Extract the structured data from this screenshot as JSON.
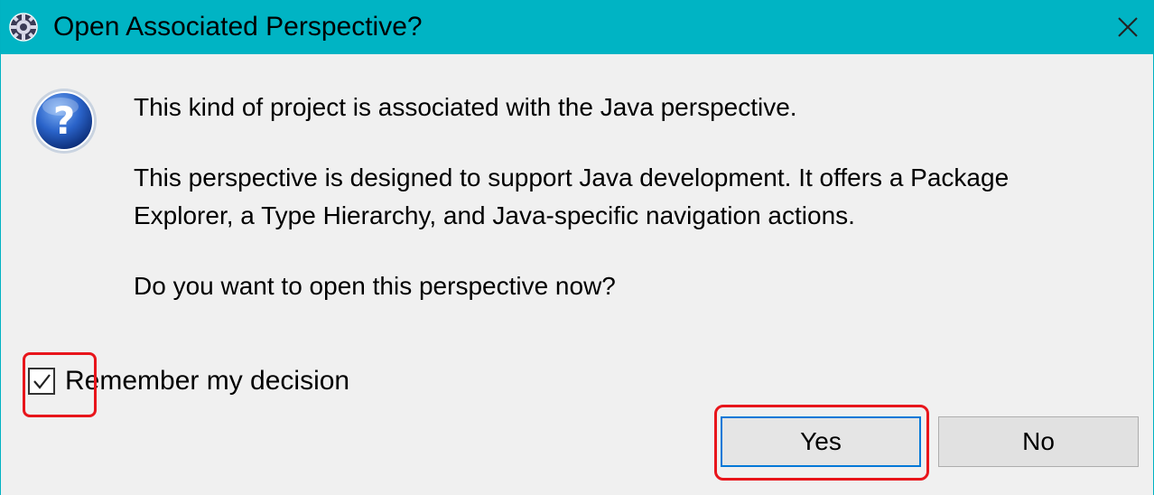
{
  "window": {
    "title": "Open Associated Perspective?",
    "app_icon": "eclipse-gear-icon",
    "close_icon": "close-icon",
    "accent_color": "#00b4c4"
  },
  "message": {
    "icon": "question-icon",
    "line1": "This kind of project is associated with the Java perspective.",
    "line2": "This perspective is designed to support Java development. It offers a Package",
    "line3": "Explorer, a Type Hierarchy, and Java-specific navigation actions.",
    "question": "Do you want to open this perspective now?"
  },
  "remember": {
    "label": "Remember my decision",
    "checked": true
  },
  "buttons": {
    "yes": "Yes",
    "no": "No"
  },
  "highlight_color": "#e8151b"
}
